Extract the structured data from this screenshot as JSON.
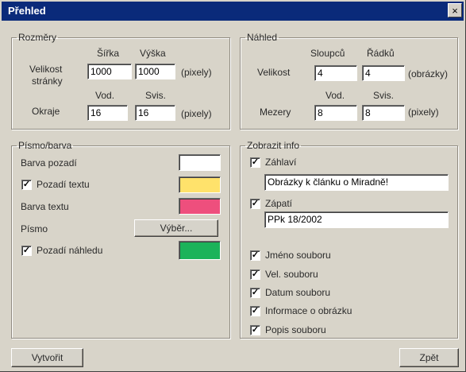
{
  "window": {
    "title": "Přehled",
    "close_label": "×"
  },
  "rozmery": {
    "legend": "Rozměry",
    "col_width": "Šířka",
    "col_height": "Výška",
    "page_size_label_line1": "Velikost",
    "page_size_label_line2": "stránky",
    "page_width": "1000",
    "page_height": "1000",
    "page_unit": "(pixely)",
    "col_horiz": "Vod.",
    "col_vert": "Svis.",
    "margins_label": "Okraje",
    "margin_h": "16",
    "margin_v": "16",
    "margin_unit": "(pixely)"
  },
  "nahled": {
    "legend": "Náhled",
    "col_columns": "Sloupců",
    "col_rows": "Řádků",
    "size_label": "Velikost",
    "columns": "4",
    "rows": "4",
    "size_unit": "(obrázky)",
    "col_horiz": "Vod.",
    "col_vert": "Svis.",
    "gaps_label": "Mezery",
    "gap_h": "8",
    "gap_v": "8",
    "gap_unit": "(pixely)"
  },
  "font_color": {
    "legend": "Písmo/barva",
    "background_label": "Barva pozadí",
    "text_bg_label": "Pozadí textu",
    "text_color_label": "Barva textu",
    "font_label": "Písmo",
    "font_button": "Výběr...",
    "preview_bg_label": "Pozadí náhledu",
    "colors": {
      "background": "#ffffff",
      "text_bg": "#ffe26b",
      "text_color": "#ee4f7d",
      "preview_bg": "#1bb35a"
    },
    "text_bg_checked": true,
    "preview_bg_checked": true
  },
  "show_info": {
    "legend": "Zobrazit info",
    "header_label": "Záhlaví",
    "header_value": "Obrázky k článku o Miradně!",
    "footer_label": "Zápatí",
    "footer_value": "PPk 18/2002",
    "items": [
      {
        "label": "Jméno souboru",
        "checked": true
      },
      {
        "label": "Vel. souboru",
        "checked": true
      },
      {
        "label": "Datum souboru",
        "checked": true
      },
      {
        "label": "Informace o obrázku",
        "checked": true
      },
      {
        "label": "Popis souboru",
        "checked": true
      }
    ]
  },
  "buttons": {
    "create": "Vytvořit",
    "back": "Zpět"
  }
}
